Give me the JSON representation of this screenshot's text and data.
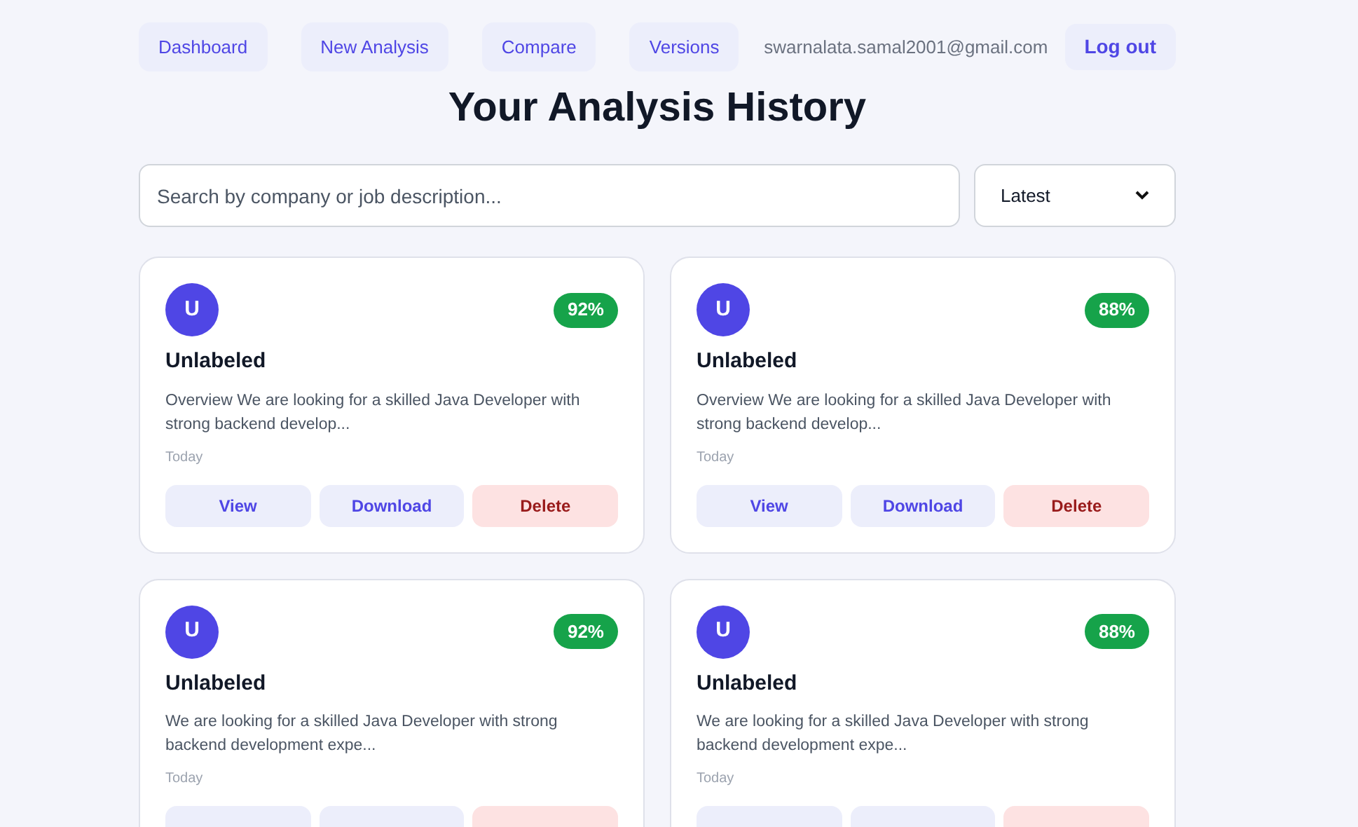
{
  "nav": {
    "links": [
      {
        "label": "Dashboard"
      },
      {
        "label": "New Analysis"
      },
      {
        "label": "Compare"
      },
      {
        "label": "Versions"
      }
    ],
    "email": "swarnalata.samal2001@gmail.com",
    "logout": "Log out"
  },
  "title": "Your Analysis History",
  "search": {
    "placeholder": "Search by company or job description..."
  },
  "sort": {
    "value": "Latest"
  },
  "cards": [
    {
      "avatar": "U",
      "score": "92%",
      "title": "Unlabeled",
      "description": "Overview We are looking for a skilled Java Developer with strong backend develop...",
      "date": "Today",
      "actions": [
        {
          "kind": "view",
          "label": "View"
        },
        {
          "kind": "download",
          "label": "Download"
        },
        {
          "kind": "delete",
          "label": "Delete"
        }
      ]
    },
    {
      "avatar": "U",
      "score": "88%",
      "title": "Unlabeled",
      "description": "Overview We are looking for a skilled Java Developer with strong backend develop...",
      "date": "Today",
      "actions": [
        {
          "kind": "view",
          "label": "View"
        },
        {
          "kind": "download",
          "label": "Download"
        },
        {
          "kind": "delete",
          "label": "Delete"
        }
      ]
    },
    {
      "avatar": "U",
      "score": "92%",
      "title": "Unlabeled",
      "description": "We are looking for a skilled Java Developer with strong backend development expe...",
      "date": "Today",
      "actions": [
        {
          "kind": "view"
        },
        {
          "kind": "download"
        },
        {
          "kind": "delete"
        }
      ]
    },
    {
      "avatar": "U",
      "score": "88%",
      "title": "Unlabeled",
      "description": "We are looking for a skilled Java Developer with strong backend development expe...",
      "date": "Today",
      "actions": [
        {
          "kind": "view"
        },
        {
          "kind": "download"
        },
        {
          "kind": "delete"
        }
      ]
    }
  ]
}
